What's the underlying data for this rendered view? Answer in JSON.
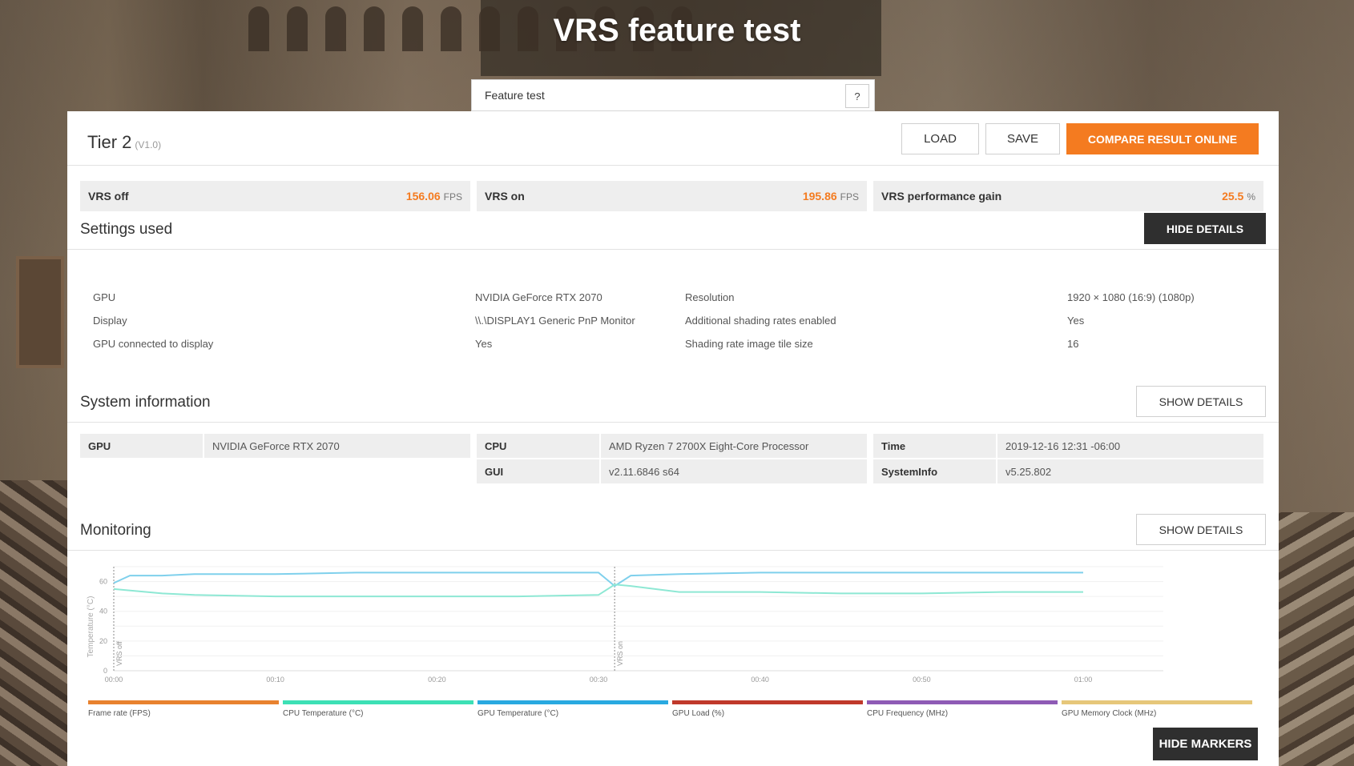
{
  "page_title": "VRS feature test",
  "feature_select": {
    "value": "Feature test",
    "help_label": "?"
  },
  "result": {
    "title": "Tier 2",
    "version": "(V1.0)"
  },
  "header_buttons": {
    "load": "LOAD",
    "save": "SAVE",
    "compare": "COMPARE RESULT ONLINE"
  },
  "scores": [
    {
      "label": "VRS off",
      "value": "156.06",
      "unit": "FPS"
    },
    {
      "label": "VRS on",
      "value": "195.86",
      "unit": "FPS"
    },
    {
      "label": "VRS performance gain",
      "value": "25.5",
      "unit": "%"
    }
  ],
  "settings": {
    "title": "Settings used",
    "button": "HIDE DETAILS",
    "rows": [
      {
        "k1": "GPU",
        "v1": "NVIDIA GeForce RTX 2070",
        "k2": "Resolution",
        "v2": "1920 × 1080 (16:9) (1080p)"
      },
      {
        "k1": "Display",
        "v1": "\\\\.\\DISPLAY1 Generic PnP Monitor",
        "k2": "Additional shading rates enabled",
        "v2": "Yes"
      },
      {
        "k1": "GPU connected to display",
        "v1": "Yes",
        "k2": "Shading rate image tile size",
        "v2": "16"
      }
    ]
  },
  "system": {
    "title": "System information",
    "button": "SHOW DETAILS",
    "gpu_k": "GPU",
    "gpu_v": "NVIDIA GeForce RTX 2070",
    "cpu_k": "CPU",
    "cpu_v": "AMD Ryzen 7 2700X Eight-Core Processor",
    "gui_k": "GUI",
    "gui_v": "v2.11.6846 s64",
    "time_k": "Time",
    "time_v": "2019-12-16 12:31 -06:00",
    "sysinfo_k": "SystemInfo",
    "sysinfo_v": "v5.25.802"
  },
  "monitoring": {
    "title": "Monitoring",
    "button": "SHOW DETAILS",
    "hide_markers": "HIDE MARKERS",
    "legend": [
      {
        "label": "Frame rate (FPS)",
        "color": "#e8822f"
      },
      {
        "label": "CPU Temperature (°C)",
        "color": "#3de0b5"
      },
      {
        "label": "GPU Temperature (°C)",
        "color": "#29a9e0"
      },
      {
        "label": "GPU Load (%)",
        "color": "#c0392b"
      },
      {
        "label": "CPU Frequency (MHz)",
        "color": "#8e5bb5"
      },
      {
        "label": "GPU Memory Clock (MHz)",
        "color": "#e6c77a"
      }
    ]
  },
  "chart_data": {
    "type": "line",
    "ylabel": "Temperature (°C)",
    "ylim": [
      0,
      70
    ],
    "yticks": [
      "0",
      "20",
      "40",
      "60"
    ],
    "xticks": [
      "00:00",
      "00:10",
      "00:20",
      "00:30",
      "00:40",
      "00:50",
      "01:00"
    ],
    "markers": [
      {
        "label": "VRS off",
        "x_sec": 0
      },
      {
        "label": "VRS on",
        "x_sec": 31
      }
    ],
    "series": [
      {
        "name": "GPU Temperature (°C)",
        "color": "#7fd0ec",
        "x_sec": [
          0,
          1,
          3,
          5,
          10,
          15,
          20,
          25,
          30,
          31,
          32,
          35,
          40,
          45,
          50,
          55,
          60
        ],
        "values": [
          59,
          64,
          64,
          65,
          65,
          66,
          66,
          66,
          66,
          57,
          64,
          65,
          66,
          66,
          66,
          66,
          66
        ]
      },
      {
        "name": "CPU Temperature (°C)",
        "color": "#8ee8d4",
        "x_sec": [
          0,
          3,
          5,
          10,
          15,
          20,
          25,
          30,
          31,
          32,
          35,
          40,
          45,
          50,
          55,
          60
        ],
        "values": [
          55,
          52,
          51,
          50,
          50,
          50,
          50,
          51,
          58,
          57,
          53,
          53,
          52,
          52,
          53,
          53
        ]
      }
    ]
  }
}
